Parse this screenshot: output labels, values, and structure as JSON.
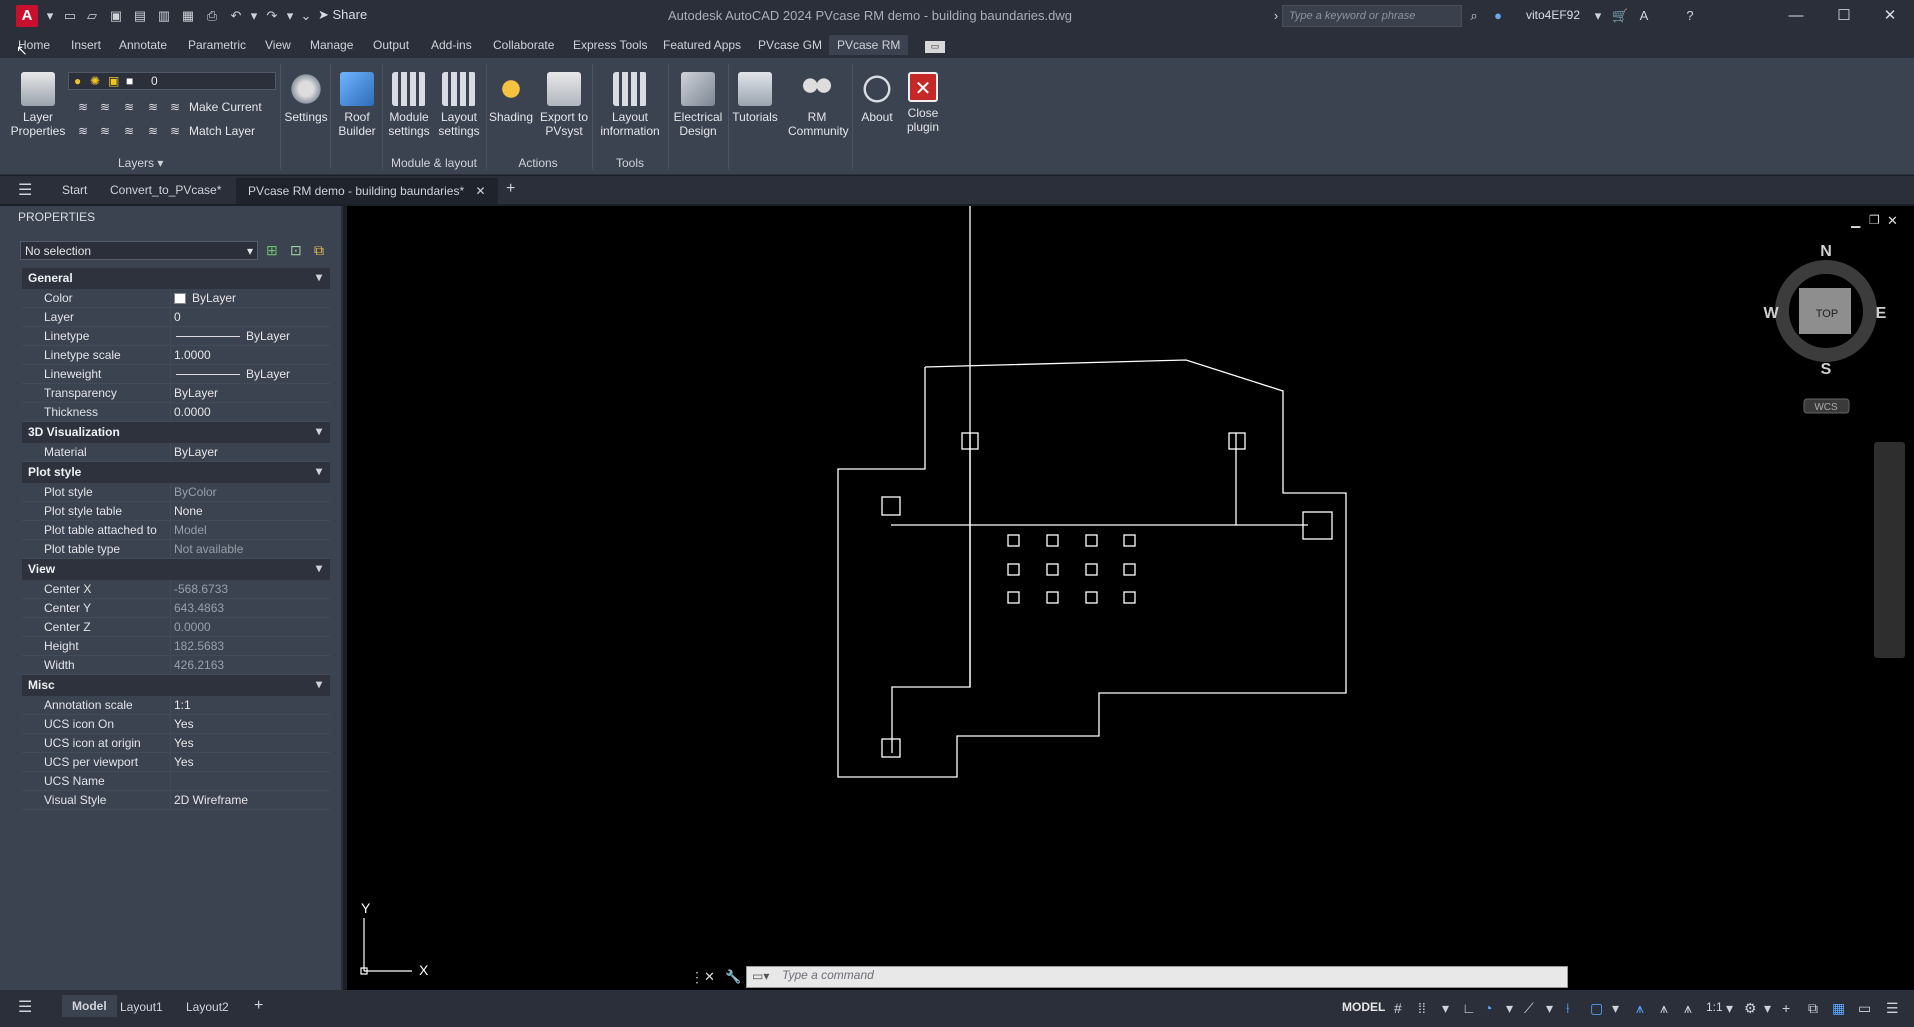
{
  "titlebar": {
    "share_label": "Share",
    "title": "Autodesk AutoCAD 2024   PVcase RM demo - building baundaries.dwg",
    "search_placeholder": "Type a keyword or phrase",
    "user": "vito4EF92"
  },
  "ribbon_tabs": [
    "Home",
    "Insert",
    "Annotate",
    "Parametric",
    "View",
    "Manage",
    "Output",
    "Add-ins",
    "Collaborate",
    "Express Tools",
    "Featured Apps",
    "PVcase GM",
    "PVcase RM"
  ],
  "ribbon": {
    "layer_properties": "Layer\nProperties",
    "layer_value": "0",
    "make_current": "Make Current",
    "match_layer": "Match Layer",
    "layers_label": "Layers",
    "buttons": [
      {
        "label": "Settings"
      },
      {
        "label": "Roof\nBuilder"
      },
      {
        "label": "Module\nsettings"
      },
      {
        "label": "Layout\nsettings"
      },
      {
        "label": "Shading"
      },
      {
        "label": "Export to\nPVsyst"
      },
      {
        "label": "Layout\ninformation"
      },
      {
        "label": "Electrical\nDesign"
      },
      {
        "label": "Tutorials"
      },
      {
        "label": "RM\nCommunity"
      },
      {
        "label": "About"
      },
      {
        "label": "Close\nplugin"
      }
    ],
    "panels": {
      "module_layout": "Module & layout",
      "actions": "Actions",
      "tools": "Tools"
    }
  },
  "file_tabs": {
    "start": "Start",
    "convert": "Convert_to_PVcase*",
    "active": "PVcase RM demo - building baundaries*"
  },
  "properties": {
    "title": "PROPERTIES",
    "selection": "No selection",
    "sections": [
      {
        "name": "General",
        "rows": [
          {
            "k": "Color",
            "v": "ByLayer"
          },
          {
            "k": "Layer",
            "v": "0"
          },
          {
            "k": "Linetype",
            "v": "ByLayer"
          },
          {
            "k": "Linetype scale",
            "v": "1.0000"
          },
          {
            "k": "Lineweight",
            "v": "ByLayer"
          },
          {
            "k": "Transparency",
            "v": "ByLayer"
          },
          {
            "k": "Thickness",
            "v": "0.0000"
          }
        ]
      },
      {
        "name": "3D Visualization",
        "rows": [
          {
            "k": "Material",
            "v": "ByLayer"
          }
        ]
      },
      {
        "name": "Plot style",
        "rows": [
          {
            "k": "Plot style",
            "v": "ByColor",
            "dim": true
          },
          {
            "k": "Plot style table",
            "v": "None"
          },
          {
            "k": "Plot table attached to",
            "v": "Model",
            "dim": true
          },
          {
            "k": "Plot table type",
            "v": "Not available",
            "dim": true
          }
        ]
      },
      {
        "name": "View",
        "rows": [
          {
            "k": "Center X",
            "v": "-568.6733",
            "dim": true
          },
          {
            "k": "Center Y",
            "v": "643.4863",
            "dim": true
          },
          {
            "k": "Center Z",
            "v": "0.0000",
            "dim": true
          },
          {
            "k": "Height",
            "v": "182.5683",
            "dim": true
          },
          {
            "k": "Width",
            "v": "426.2163",
            "dim": true
          }
        ]
      },
      {
        "name": "Misc",
        "rows": [
          {
            "k": "Annotation scale",
            "v": "1:1"
          },
          {
            "k": "UCS icon On",
            "v": "Yes"
          },
          {
            "k": "UCS icon at origin",
            "v": "Yes"
          },
          {
            "k": "UCS per viewport",
            "v": "Yes"
          },
          {
            "k": "UCS Name",
            "v": ""
          },
          {
            "k": "Visual Style",
            "v": "2D Wireframe"
          }
        ]
      }
    ]
  },
  "viewcube": {
    "n": "N",
    "s": "S",
    "e": "E",
    "w": "W",
    "top": "TOP",
    "wcs": "WCS"
  },
  "ucs": {
    "x": "X",
    "y": "Y"
  },
  "command": {
    "placeholder": "Type a command"
  },
  "statusbar": {
    "tabs": [
      "Model",
      "Layout1",
      "Layout2"
    ],
    "model_label": "MODEL",
    "scale": "1:1"
  }
}
